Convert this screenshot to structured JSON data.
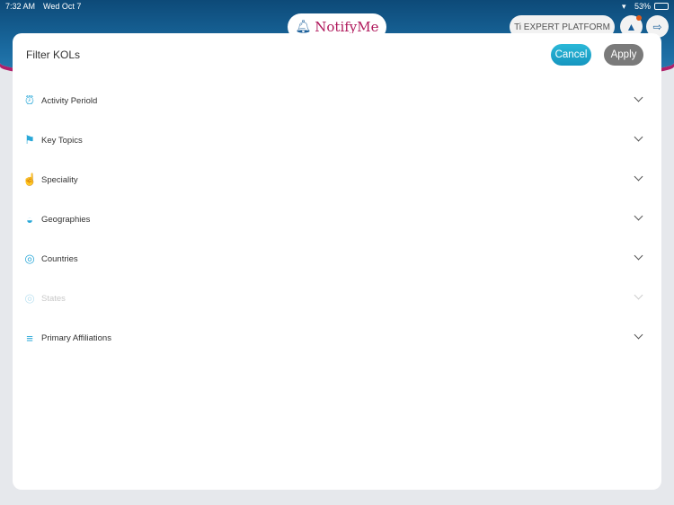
{
  "status_bar": {
    "time": "7:32 AM",
    "date": "Wed Oct 7",
    "battery": "53%"
  },
  "header": {
    "app_name": "NotifyMe",
    "platform_label": "Ti EXPERT PLATFORM"
  },
  "modal": {
    "title": "Filter KOLs",
    "cancel_label": "Cancel",
    "apply_label": "Apply",
    "filters": [
      {
        "label": "Activity Periold",
        "icon": "alarm-clock-icon",
        "enabled": true
      },
      {
        "label": "Key Topics",
        "icon": "flag-icon",
        "enabled": true
      },
      {
        "label": "Speciality",
        "icon": "thumbs-up-icon",
        "enabled": true
      },
      {
        "label": "Geographies",
        "icon": "globe-flag-icon",
        "enabled": true
      },
      {
        "label": "Countries",
        "icon": "location-pin-icon",
        "enabled": true
      },
      {
        "label": "States",
        "icon": "location-pin-icon",
        "enabled": false
      },
      {
        "label": "Primary Affiliations",
        "icon": "handshake-icon",
        "enabled": true
      }
    ]
  }
}
